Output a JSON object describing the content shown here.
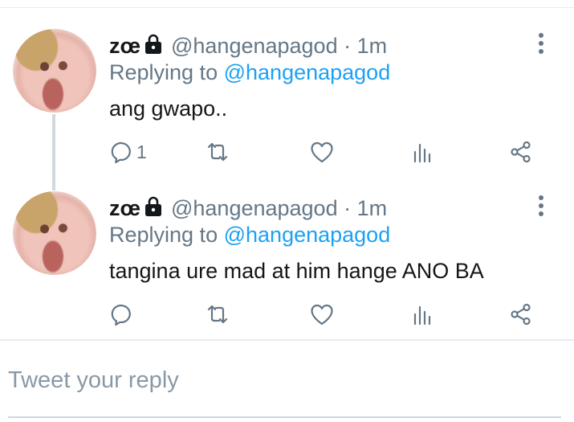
{
  "tweets": [
    {
      "name": "zœ",
      "handle": "@hangenapagod",
      "separator": "·",
      "time": "1m",
      "replying_prefix": "Replying to",
      "replying_handle": "@hangenapagod",
      "text": "ang gwapo..",
      "reply_count": "1"
    },
    {
      "name": "zœ",
      "handle": "@hangenapagod",
      "separator": "·",
      "time": "1m",
      "replying_prefix": "Replying to",
      "replying_handle": "@hangenapagod",
      "text": "tangina ure mad at him hange ANO BA",
      "reply_count": ""
    }
  ],
  "reply_box": {
    "placeholder": "Tweet your reply"
  },
  "colors": {
    "link": "#1da1f2",
    "muted": "#657786",
    "text": "#14171a",
    "divider": "#e6ecf0"
  },
  "icons": [
    "lock-icon",
    "more-vertical-icon",
    "reply-icon",
    "retweet-icon",
    "heart-icon",
    "stats-icon",
    "share-icon"
  ]
}
